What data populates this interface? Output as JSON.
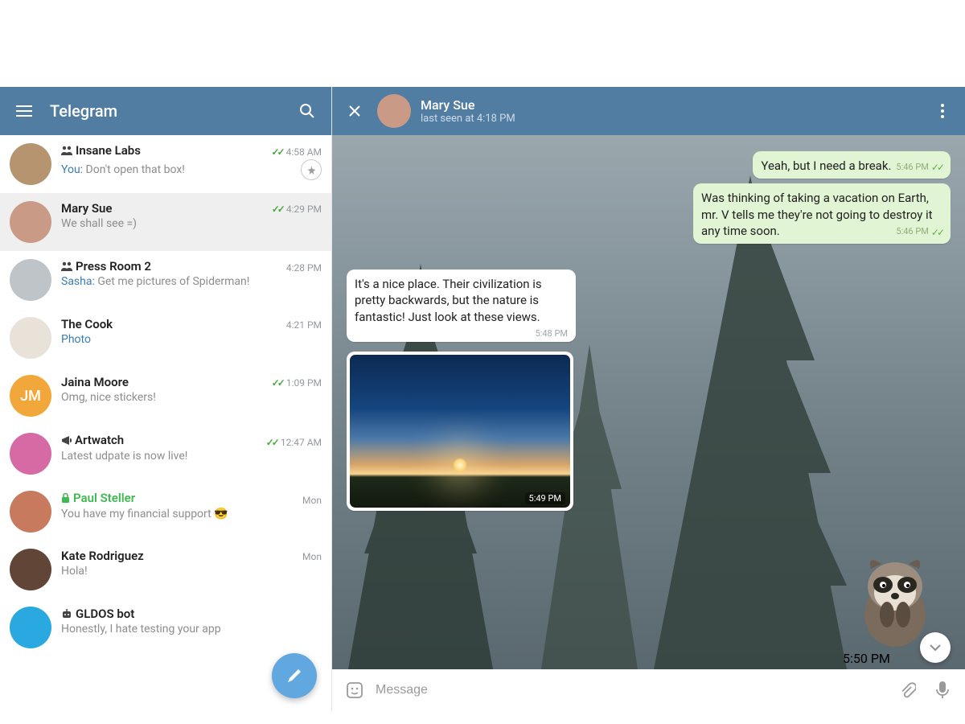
{
  "header": {
    "title": "Telegram"
  },
  "chats": [
    {
      "name": "Insane Labs",
      "icon": "group",
      "preview_prefix": "You:",
      "preview": " Don't open that box!",
      "time": "4:58 AM",
      "checks": true,
      "pinned": true,
      "avatar_bg": "#b5946f"
    },
    {
      "name": "Mary Sue",
      "preview": "We shall see =)",
      "time": "4:29 PM",
      "checks": true,
      "avatar_bg": "#c99a86",
      "selected": true
    },
    {
      "name": "Press Room 2",
      "icon": "group",
      "preview_sender": "Sasha:",
      "preview": " Get me pictures of Spiderman!",
      "time": "4:28 PM",
      "avatar_bg": "#bfc4c8"
    },
    {
      "name": "The Cook",
      "preview_link": "Photo",
      "time": "4:21 PM",
      "avatar_bg": "#e8e2d8"
    },
    {
      "name": "Jaina Moore",
      "initials": "JM",
      "preview": "Omg, nice stickers!",
      "time": "1:09 PM",
      "checks": true,
      "avatar_bg": "#f2a73b"
    },
    {
      "name": "Artwatch",
      "icon": "channel",
      "preview": "Latest udpate is now live!",
      "time": "12:47 AM",
      "checks": true,
      "avatar_bg": "#d66aa4"
    },
    {
      "name": "Paul Steller",
      "icon": "lock",
      "secure": true,
      "preview": "You have my financial support 😎",
      "time": "Mon",
      "avatar_bg": "#c77a5e"
    },
    {
      "name": "Kate Rodriguez",
      "preview": "Hola!",
      "time": "Mon",
      "avatar_bg": "#614637"
    },
    {
      "name": "GLDOS bot",
      "icon": "bot",
      "preview": "Honestly, I hate testing your app",
      "time": "",
      "avatar_bg": "#2aa8e0"
    }
  ],
  "conversation": {
    "name": "Mary Sue",
    "status": "last seen at 4:18 PM",
    "msg_out1": {
      "text": "Yeah, but I need a break.",
      "time": "5:46 PM"
    },
    "msg_out2": {
      "text": "Was thinking of taking a vacation on Earth, mr. V tells me they're not going to destroy it any time soon.",
      "time": "5:46 PM"
    },
    "msg_in1": {
      "text": "It's a nice place. Their civilization is pretty backwards, but the nature is fantastic! Just look at these views.",
      "time": "5:48 PM"
    },
    "photo_time": "5:49 PM",
    "sticker_time": "5:50 PM"
  },
  "composer": {
    "placeholder": "Message"
  }
}
